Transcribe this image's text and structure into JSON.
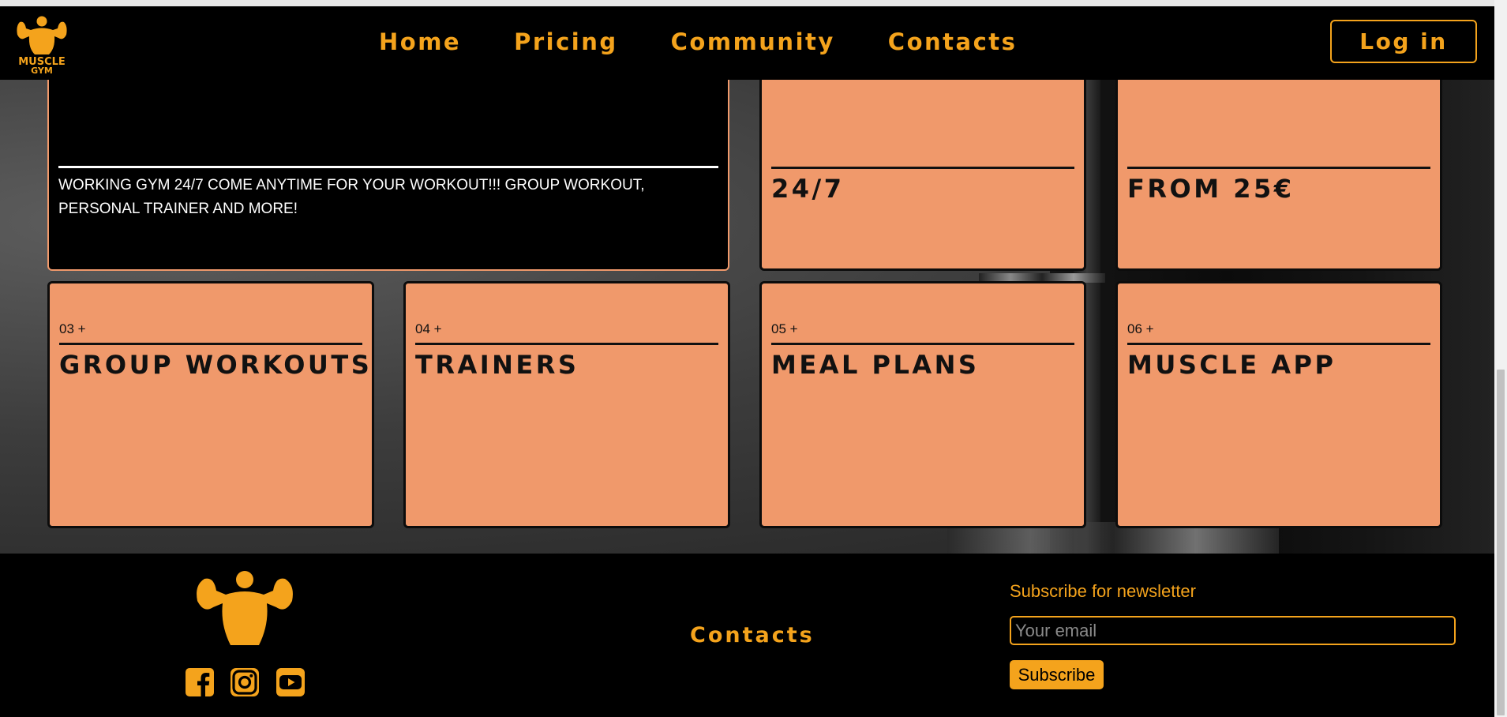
{
  "header": {
    "logo_text_line1": "MUSCLE",
    "logo_text_line2": "GYM",
    "nav": [
      "Home",
      "Pricing",
      "Community",
      "Contacts"
    ],
    "login_label": "Log in"
  },
  "features": {
    "intro_description": "WORKING GYM 24/7 COME ANYTIME FOR YOUR WORKOUT!!! GROUP WORKOUT, PERSONAL TRAINER AND MORE!",
    "cards_top": [
      "24/7",
      "FROM 25€"
    ],
    "cards_bottom": [
      {
        "num": "03 +",
        "title": "GROUP WORKOUTS"
      },
      {
        "num": "04 +",
        "title": "TRAINERS"
      },
      {
        "num": "05 +",
        "title": "MEAL PLANS"
      },
      {
        "num": "06 +",
        "title": "MUSCLE APP"
      }
    ]
  },
  "footer": {
    "contacts_label": "Contacts",
    "newsletter_label": "Subscribe for newsletter",
    "email_placeholder": "Your email",
    "subscribe_label": "Subscribe",
    "social_icons": [
      "facebook-icon",
      "instagram-icon",
      "youtube-icon"
    ]
  },
  "colors": {
    "accent": "#f4a31c",
    "card": "#f0996b",
    "background": "#000000"
  }
}
